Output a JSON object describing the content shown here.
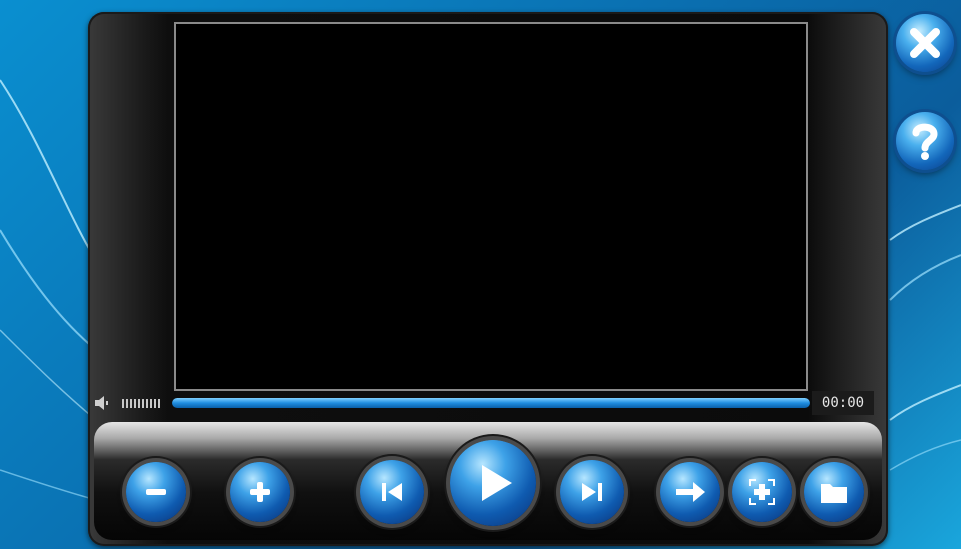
{
  "app": {
    "time_display": "00:00",
    "volume_level": 0.95,
    "progress": 1.0
  },
  "icons": {
    "volume": "speaker-icon",
    "close": "close-x-icon",
    "help": "question-mark-icon",
    "volume_down": "minus-icon",
    "volume_up": "plus-icon",
    "previous": "skip-previous-icon",
    "play": "play-icon",
    "next": "skip-next-icon",
    "forward": "arrow-right-icon",
    "fullscreen": "fullscreen-icon",
    "open": "folder-icon"
  },
  "colors": {
    "accent": "#1f8de0",
    "background": "#0a6fb0"
  }
}
